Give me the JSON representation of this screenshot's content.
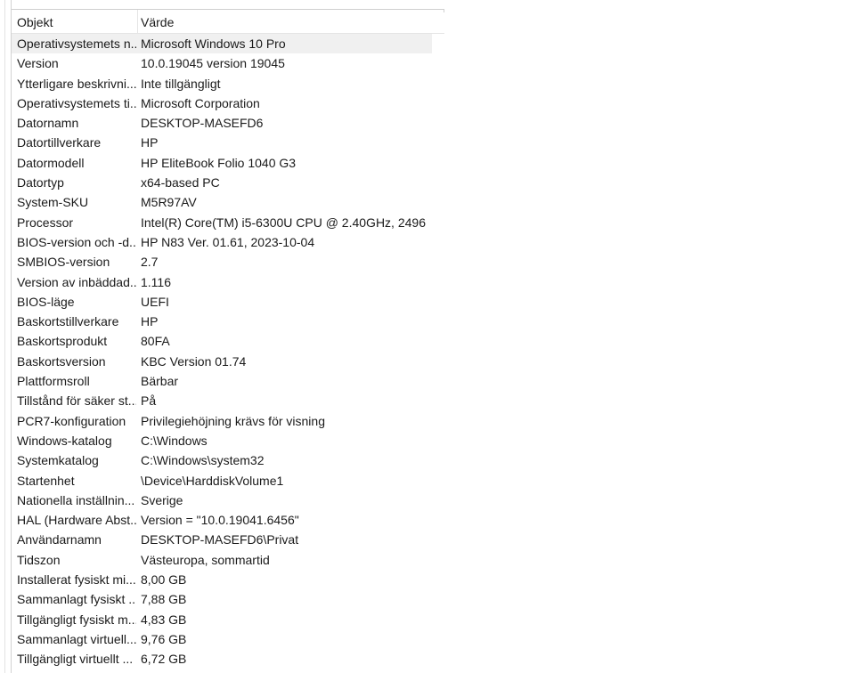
{
  "table": {
    "headers": {
      "object": "Objekt",
      "value": "Värde"
    },
    "rows": [
      {
        "object": "Operativsystemets n...",
        "value": "Microsoft Windows 10 Pro"
      },
      {
        "object": "Version",
        "value": "10.0.19045 version 19045"
      },
      {
        "object": "Ytterligare beskrivni...",
        "value": "Inte tillgängligt"
      },
      {
        "object": "Operativsystemets ti...",
        "value": "Microsoft Corporation"
      },
      {
        "object": "Datornamn",
        "value": "DESKTOP-MASEFD6"
      },
      {
        "object": "Datortillverkare",
        "value": "HP"
      },
      {
        "object": "Datormodell",
        "value": "HP EliteBook Folio 1040 G3"
      },
      {
        "object": "Datortyp",
        "value": "x64-based PC"
      },
      {
        "object": "System-SKU",
        "value": "M5R97AV"
      },
      {
        "object": "Processor",
        "value": "Intel(R) Core(TM) i5-6300U CPU @ 2.40GHz, 2496 ..."
      },
      {
        "object": "BIOS-version och -d...",
        "value": "HP N83 Ver. 01.61, 2023-10-04"
      },
      {
        "object": "SMBIOS-version",
        "value": "2.7"
      },
      {
        "object": "Version av inbäddad...",
        "value": "1.116"
      },
      {
        "object": "BIOS-läge",
        "value": "UEFI"
      },
      {
        "object": "Baskortstillverkare",
        "value": "HP"
      },
      {
        "object": "Baskortsprodukt",
        "value": "80FA"
      },
      {
        "object": "Baskortsversion",
        "value": "KBC Version 01.74"
      },
      {
        "object": "Plattformsroll",
        "value": "Bärbar"
      },
      {
        "object": "Tillstånd för säker st...",
        "value": "På"
      },
      {
        "object": "PCR7-konfiguration",
        "value": "Privilegiehöjning krävs för visning"
      },
      {
        "object": "Windows-katalog",
        "value": "C:\\Windows"
      },
      {
        "object": "Systemkatalog",
        "value": "C:\\Windows\\system32"
      },
      {
        "object": "Startenhet",
        "value": "\\Device\\HarddiskVolume1"
      },
      {
        "object": "Nationella inställnin...",
        "value": "Sverige"
      },
      {
        "object": "HAL (Hardware Abst...",
        "value": "Version = \"10.0.19041.6456\""
      },
      {
        "object": "Användarnamn",
        "value": "DESKTOP-MASEFD6\\Privat"
      },
      {
        "object": "Tidszon",
        "value": "Västeuropa, sommartid"
      },
      {
        "object": "Installerat fysiskt mi...",
        "value": "8,00 GB"
      },
      {
        "object": "Sammanlagt fysiskt ...",
        "value": "7,88 GB"
      },
      {
        "object": "Tillgängligt fysiskt m...",
        "value": "4,83 GB"
      },
      {
        "object": "Sammanlagt virtuell...",
        "value": "9,76 GB"
      },
      {
        "object": "Tillgängligt virtuellt ...",
        "value": "6,72 GB"
      }
    ]
  }
}
